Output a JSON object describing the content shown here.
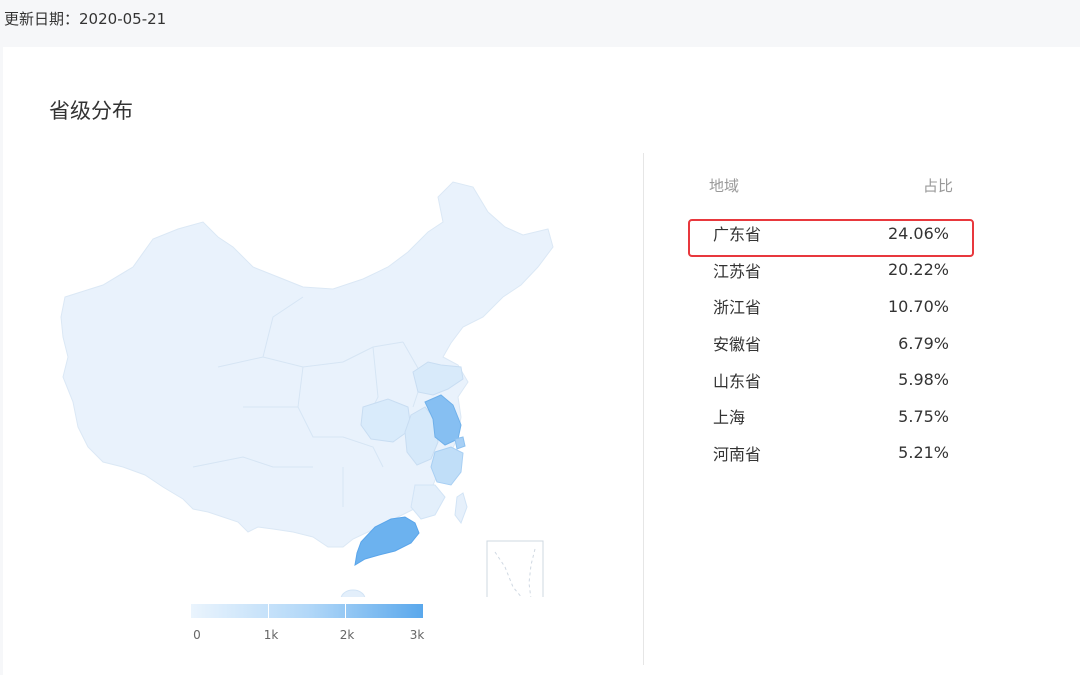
{
  "header": {
    "update_label": "更新日期：",
    "update_date": "2020-05-21"
  },
  "card": {
    "title": "省级分布"
  },
  "legend": {
    "labels": [
      "0",
      "1k",
      "2k",
      "3k"
    ],
    "colors": [
      "#eaf4fd",
      "#b3d8f8",
      "#5aa8ec"
    ]
  },
  "table": {
    "col_region": "地域",
    "col_ratio": "占比",
    "rows": [
      {
        "region": "广东省",
        "ratio": "24.06%"
      },
      {
        "region": "江苏省",
        "ratio": "20.22%"
      },
      {
        "region": "浙江省",
        "ratio": "10.70%"
      },
      {
        "region": "安徽省",
        "ratio": "6.79%"
      },
      {
        "region": "山东省",
        "ratio": "5.98%"
      },
      {
        "region": "上海",
        "ratio": "5.75%"
      },
      {
        "region": "河南省",
        "ratio": "5.21%"
      }
    ]
  },
  "colors": {
    "map_base": "#e8f2fc",
    "guangdong": "#6cb2ef",
    "jiangsu": "#86bff2",
    "zhejiang": "#c0def8",
    "anhui": "#d6e9fa",
    "shandong": "#d8eafa",
    "henan": "#d9ebfb",
    "highlight": "#e8383d"
  }
}
